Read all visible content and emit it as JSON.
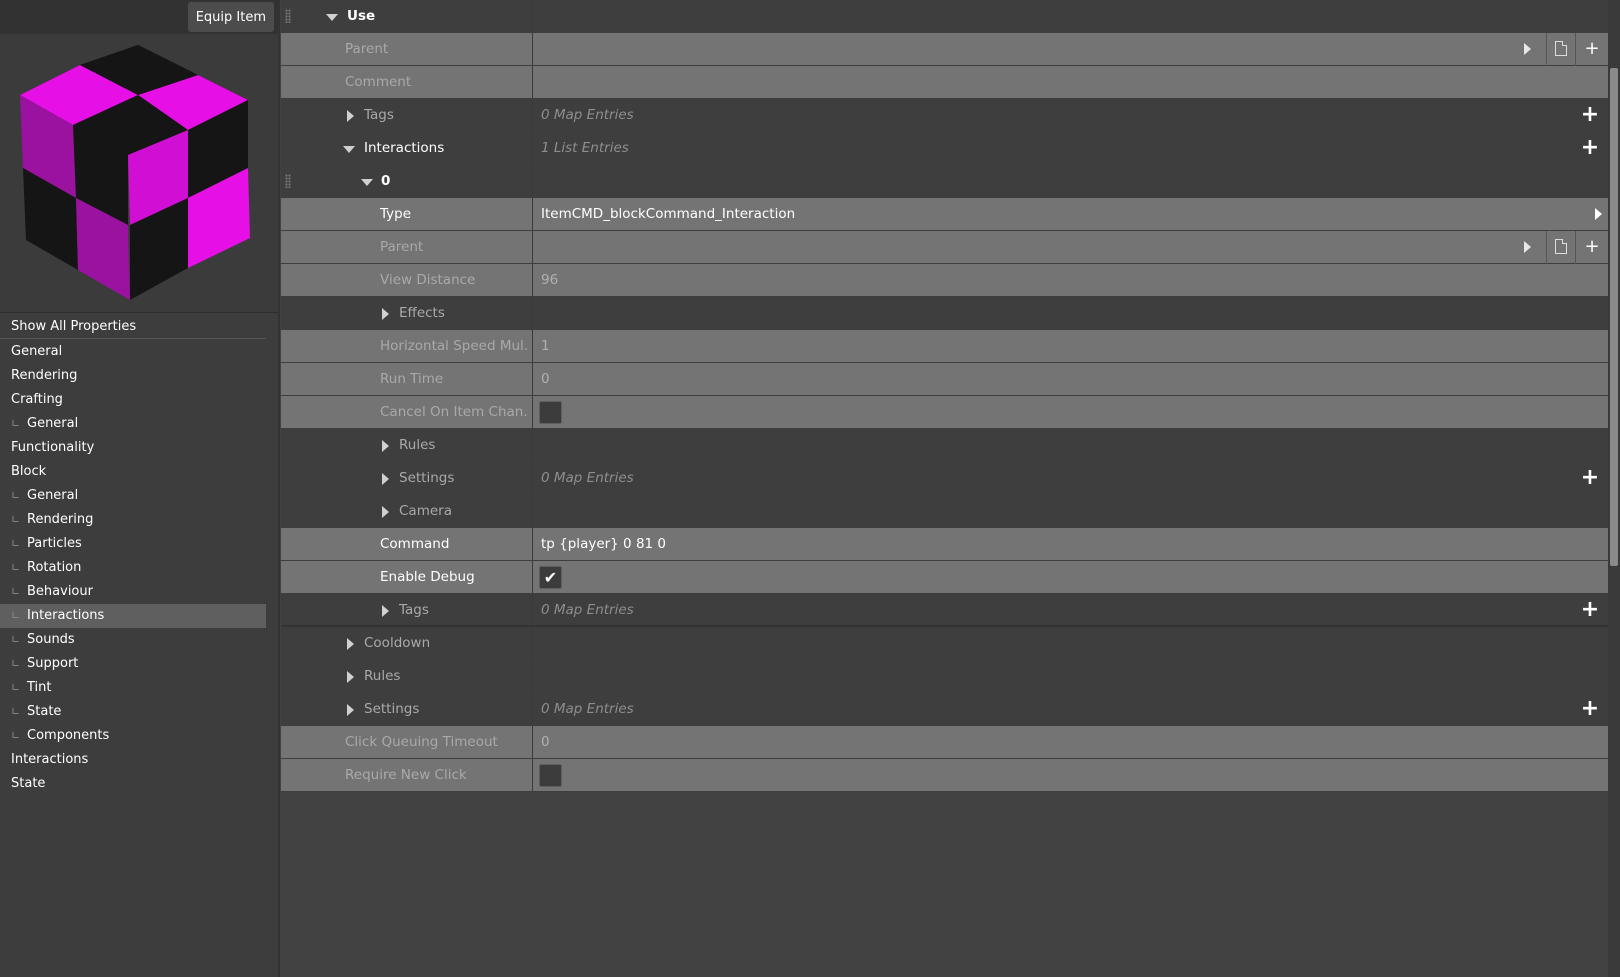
{
  "toolbar": {
    "equip_label": "Equip Item"
  },
  "preview": {
    "icon": "checkered-cube-icon",
    "colors": {
      "magenta": "#e60fe6",
      "black": "#151515"
    }
  },
  "nav": {
    "items": [
      {
        "label": "Show All Properties",
        "kind": "header"
      },
      {
        "label": "General",
        "kind": "top"
      },
      {
        "label": "Rendering",
        "kind": "top"
      },
      {
        "label": "Crafting",
        "kind": "top"
      },
      {
        "label": "General",
        "kind": "sub"
      },
      {
        "label": "Functionality",
        "kind": "top"
      },
      {
        "label": "Block",
        "kind": "top"
      },
      {
        "label": "General",
        "kind": "sub"
      },
      {
        "label": "Rendering",
        "kind": "sub"
      },
      {
        "label": "Particles",
        "kind": "sub"
      },
      {
        "label": "Rotation",
        "kind": "sub"
      },
      {
        "label": "Behaviour",
        "kind": "sub"
      },
      {
        "label": "Interactions",
        "kind": "sub",
        "active": true
      },
      {
        "label": "Sounds",
        "kind": "sub"
      },
      {
        "label": "Support",
        "kind": "sub"
      },
      {
        "label": "Tint",
        "kind": "sub"
      },
      {
        "label": "State",
        "kind": "sub"
      },
      {
        "label": "Components",
        "kind": "sub"
      },
      {
        "label": "Interactions",
        "kind": "top"
      },
      {
        "label": "State",
        "kind": "top"
      }
    ]
  },
  "grid": {
    "rows": [
      {
        "label": "Use",
        "level": 0,
        "expander": "down",
        "bold": true,
        "tone": "dark",
        "grip": true
      },
      {
        "label": "Parent",
        "level": 1,
        "tone": "mid",
        "dim": true,
        "ref": true
      },
      {
        "label": "Comment",
        "level": 1,
        "tone": "mid",
        "dim": true
      },
      {
        "label": "Tags",
        "level": 1,
        "expander": "right",
        "tone": "dark",
        "dim": true,
        "hint": "0 Map Entries",
        "plus": true
      },
      {
        "label": "Interactions",
        "level": 1,
        "expander": "down",
        "tone": "dark",
        "hint": "1 List Entries",
        "plus": true
      },
      {
        "label": "0",
        "level": 2,
        "expander": "down",
        "bold": true,
        "tone": "dark",
        "grip": true
      },
      {
        "label": "Type",
        "level": 3,
        "tone": "mid",
        "value": "ItemCMD_blockCommand_Interaction",
        "dropdown": true
      },
      {
        "label": "Parent",
        "level": 3,
        "tone": "mid",
        "dim": true,
        "ref": true
      },
      {
        "label": "View Distance",
        "level": 3,
        "tone": "mid",
        "dim": true,
        "value": "96",
        "value_dim": true
      },
      {
        "label": "Effects",
        "level": 3,
        "expander": "right",
        "tone": "dark",
        "dim": true
      },
      {
        "label": "Horizontal Speed Mul...",
        "level": 3,
        "tone": "mid",
        "dim": true,
        "value": "1",
        "value_dim": true
      },
      {
        "label": "Run Time",
        "level": 3,
        "tone": "mid",
        "dim": true,
        "value": "0",
        "value_dim": true
      },
      {
        "label": "Cancel On Item Chan...",
        "level": 3,
        "tone": "mid",
        "dim": true,
        "checkbox": false
      },
      {
        "label": "Rules",
        "level": 3,
        "expander": "right",
        "tone": "dark",
        "dim": true
      },
      {
        "label": "Settings",
        "level": 3,
        "expander": "right",
        "tone": "dark",
        "dim": true,
        "hint": "0 Map Entries",
        "plus": true
      },
      {
        "label": "Camera",
        "level": 3,
        "expander": "right",
        "tone": "dark",
        "dim": true
      },
      {
        "label": "Command",
        "level": 3,
        "tone": "mid",
        "value": "tp {player} 0 81 0"
      },
      {
        "label": "Enable Debug",
        "level": 3,
        "tone": "mid",
        "checkbox": true
      },
      {
        "label": "Tags",
        "level": 3,
        "expander": "right",
        "tone": "dark",
        "dim": true,
        "hint": "0 Map Entries",
        "plus": true,
        "sep": true
      },
      {
        "label": "Cooldown",
        "level": 1,
        "expander": "right",
        "tone": "dark",
        "dim": true
      },
      {
        "label": "Rules",
        "level": 1,
        "expander": "right",
        "tone": "dark",
        "dim": true
      },
      {
        "label": "Settings",
        "level": 1,
        "expander": "right",
        "tone": "dark",
        "dim": true,
        "hint": "0 Map Entries",
        "plus": true
      },
      {
        "label": "Click Queuing Timeout",
        "level": 1,
        "tone": "mid",
        "dim": true,
        "value": "0",
        "value_dim": true
      },
      {
        "label": "Require New Click",
        "level": 1,
        "tone": "mid",
        "dim": true,
        "checkbox": false
      }
    ]
  },
  "icons": {
    "plus": "+",
    "check": "✔",
    "add_ref": "+",
    "doc": "document-icon"
  }
}
